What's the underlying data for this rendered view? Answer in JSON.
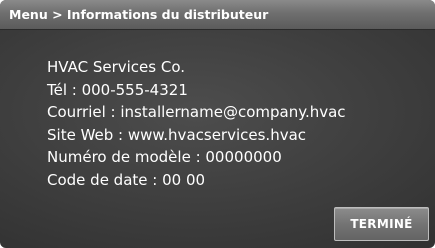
{
  "header": {
    "breadcrumb": "Menu > Informations du distributeur"
  },
  "info": {
    "company": "HVAC Services Co.",
    "phone": "Tél : 000-555-4321",
    "email": "Courriel : installername@company.hvac",
    "website": "Site Web : www.hvacservices.hvac",
    "model": "Numéro de modèle : 00000000",
    "date_code": "Code de date : 00 00"
  },
  "buttons": {
    "done_label": "TERMINÉ"
  }
}
